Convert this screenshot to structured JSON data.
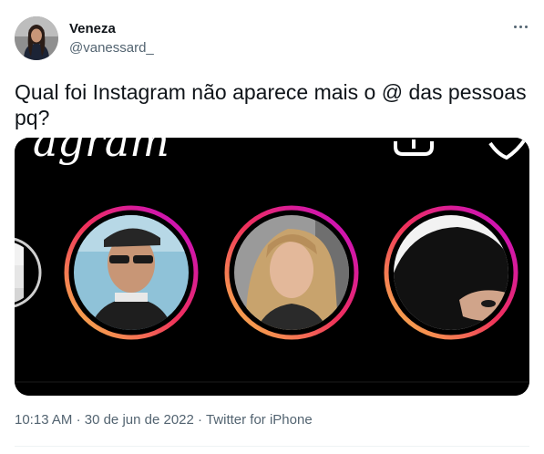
{
  "author": {
    "name": "Veneza",
    "handle": "@vanessard_"
  },
  "tweet": {
    "text": "Qual foi Instagram não aparece mais o @ das pessoas pq?"
  },
  "media": {
    "header_partial_text": "agram",
    "stories": [
      {
        "subject": "man with sunglasses and backwards cap"
      },
      {
        "subject": "woman with wavy blonde hair"
      },
      {
        "subject": "person with black hood"
      }
    ]
  },
  "meta": {
    "time": "10:13 AM",
    "separator": "·",
    "date": "30 de jun de 2022",
    "source": "Twitter for iPhone"
  },
  "icons": {
    "more": "more-horizontal-icon",
    "new_post": "new-post-icon",
    "heart": "heart-icon"
  },
  "colors": {
    "name": "#0f1419",
    "secondary": "#536471",
    "story_ring_start": "#f9c44a",
    "story_ring_mid": "#f0305b",
    "story_ring_end": "#c30ad0"
  }
}
